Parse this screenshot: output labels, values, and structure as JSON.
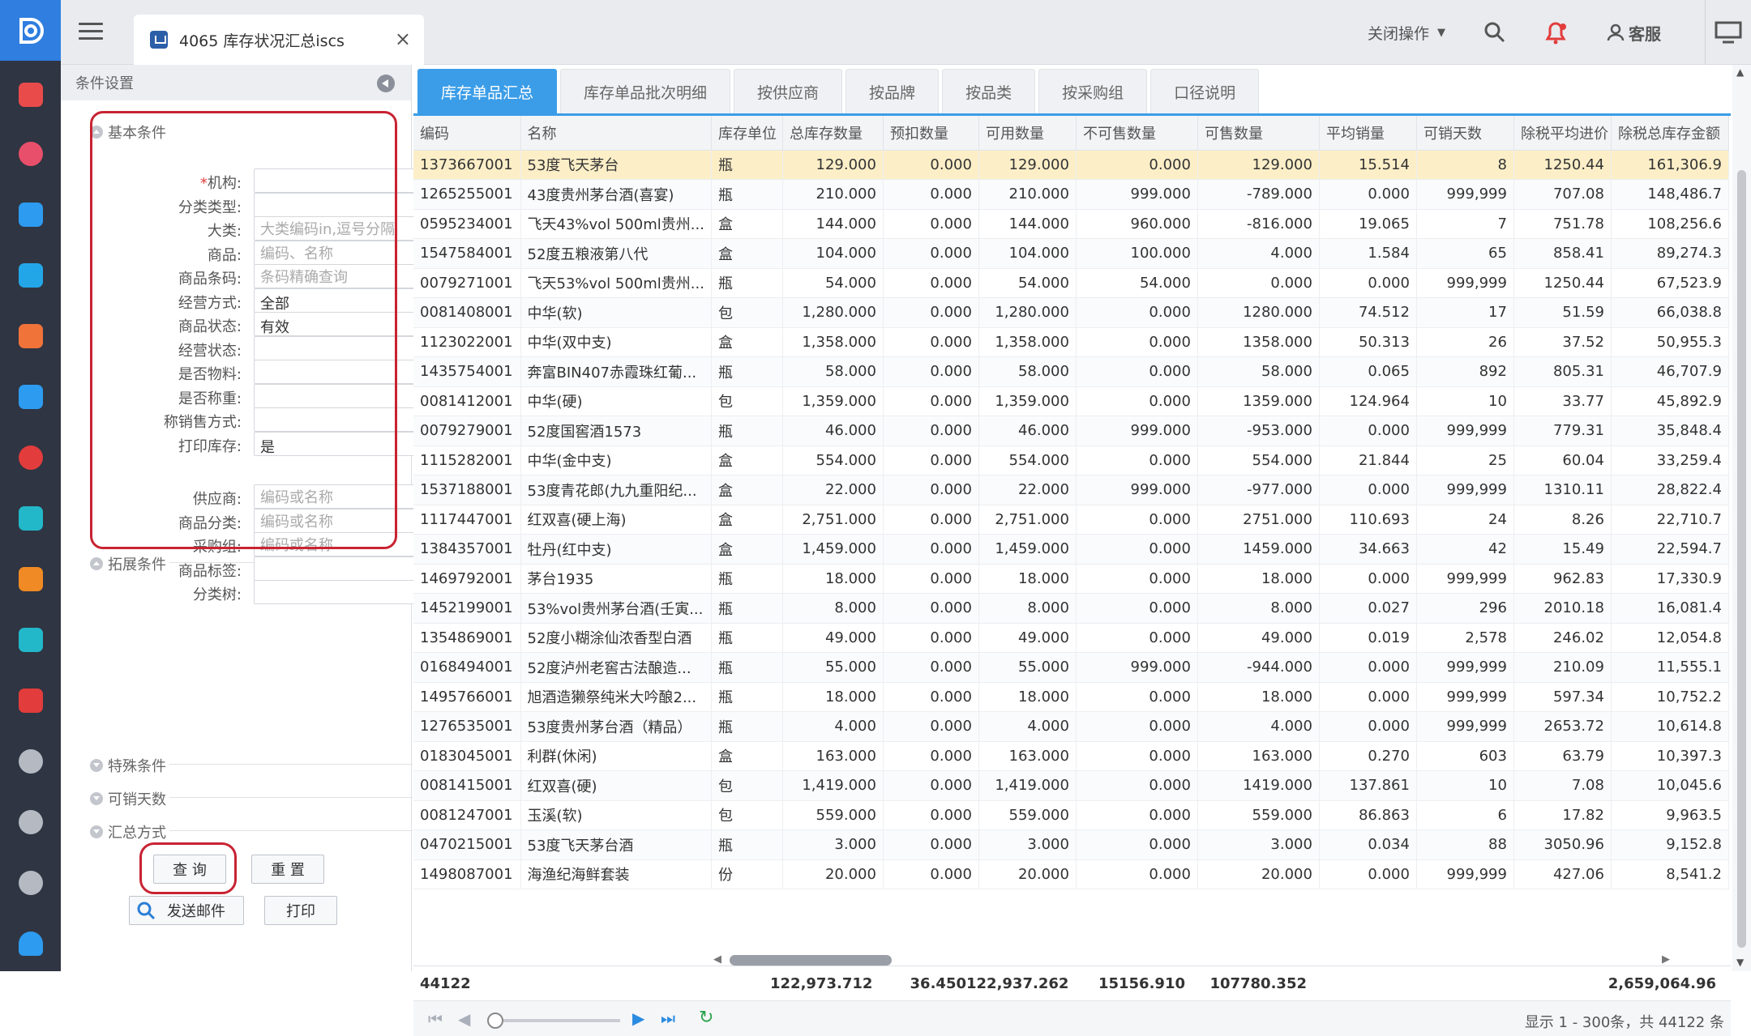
{
  "app": {
    "tab_title": "4065 库存状况汇总iscs",
    "tab_close": "×"
  },
  "topbar": {
    "close_ops": "关闭操作",
    "service": "客服"
  },
  "panel": {
    "title": "条件设置",
    "sections": {
      "basic": "基本条件",
      "extended": "拓展条件",
      "special": "特殊条件",
      "days": "可销天数",
      "summary": "汇总方式"
    },
    "basic_fields": [
      {
        "label": "机构:",
        "required": true,
        "value": "",
        "placeholder": "",
        "select": true
      },
      {
        "label": "分类类型:",
        "value": "",
        "placeholder": "",
        "select": true
      },
      {
        "label": "大类:",
        "value": "",
        "placeholder": "大类编码in,逗号分隔",
        "select": false
      },
      {
        "label": "商品:",
        "value": "",
        "placeholder": "编码、名称",
        "select": false
      },
      {
        "label": "商品条码:",
        "value": "",
        "placeholder": "条码精确查询",
        "select": false
      },
      {
        "label": "经营方式:",
        "value": "全部",
        "placeholder": "",
        "select": true
      },
      {
        "label": "商品状态:",
        "value": "有效",
        "placeholder": "",
        "select": true
      },
      {
        "label": "经营状态:",
        "value": "",
        "placeholder": "",
        "select": true
      },
      {
        "label": "是否物料:",
        "value": "",
        "placeholder": "",
        "select": true
      },
      {
        "label": "是否称重:",
        "value": "",
        "placeholder": "",
        "select": true
      },
      {
        "label": "称销售方式:",
        "value": "",
        "placeholder": "",
        "select": true
      },
      {
        "label": "打印库存:",
        "value": "是",
        "placeholder": "",
        "select": true
      }
    ],
    "ext_fields": [
      {
        "label": "供应商:",
        "value": "",
        "placeholder": "编码或名称",
        "select": false
      },
      {
        "label": "商品分类:",
        "value": "",
        "placeholder": "编码或名称",
        "select": false
      },
      {
        "label": "采购组:",
        "value": "",
        "placeholder": "编码或名称",
        "select": false
      },
      {
        "label": "商品标签:",
        "value": "",
        "placeholder": "",
        "select": true
      },
      {
        "label": "分类树:",
        "value": "",
        "placeholder": "",
        "select": true
      }
    ],
    "buttons": {
      "query": "查 询",
      "reset": "重 置",
      "send_mail": "发送邮件",
      "print": "打印"
    }
  },
  "subtabs": [
    "库存单品汇总",
    "库存单品批次明细",
    "按供应商",
    "按品牌",
    "按品类",
    "按采购组",
    "口径说明"
  ],
  "table": {
    "columns": [
      "编码",
      "名称",
      "库存单位",
      "总库存数量",
      "预扣数量",
      "可用数量",
      "不可售数量",
      "可售数量",
      "平均销量",
      "可销天数",
      "除税平均进价",
      "除税总库存金额"
    ],
    "rows": [
      [
        "1373667001",
        "53度飞天茅台",
        "瓶",
        "129.000",
        "0.000",
        "129.000",
        "0.000",
        "129.000",
        "15.514",
        "8",
        "1250.44",
        "161,306.9"
      ],
      [
        "1265255001",
        "43度贵州茅台酒(喜宴)",
        "瓶",
        "210.000",
        "0.000",
        "210.000",
        "999.000",
        "-789.000",
        "0.000",
        "999,999",
        "707.08",
        "148,486.7"
      ],
      [
        "0595234001",
        "飞天43%vol 500ml贵州...",
        "盒",
        "144.000",
        "0.000",
        "144.000",
        "960.000",
        "-816.000",
        "19.065",
        "7",
        "751.78",
        "108,256.6"
      ],
      [
        "1547584001",
        "52度五粮液第八代",
        "盒",
        "104.000",
        "0.000",
        "104.000",
        "100.000",
        "4.000",
        "1.584",
        "65",
        "858.41",
        "89,274.3"
      ],
      [
        "0079271001",
        "飞天53%vol 500ml贵州...",
        "瓶",
        "54.000",
        "0.000",
        "54.000",
        "54.000",
        "0.000",
        "0.000",
        "999,999",
        "1250.44",
        "67,523.9"
      ],
      [
        "0081408001",
        "中华(软)",
        "包",
        "1,280.000",
        "0.000",
        "1,280.000",
        "0.000",
        "1280.000",
        "74.512",
        "17",
        "51.59",
        "66,038.8"
      ],
      [
        "1123022001",
        "中华(双中支)",
        "盒",
        "1,358.000",
        "0.000",
        "1,358.000",
        "0.000",
        "1358.000",
        "50.313",
        "26",
        "37.52",
        "50,955.3"
      ],
      [
        "1435754001",
        "奔富BIN407赤霞珠红葡...",
        "瓶",
        "58.000",
        "0.000",
        "58.000",
        "0.000",
        "58.000",
        "0.065",
        "892",
        "805.31",
        "46,707.9"
      ],
      [
        "0081412001",
        "中华(硬)",
        "包",
        "1,359.000",
        "0.000",
        "1,359.000",
        "0.000",
        "1359.000",
        "124.964",
        "10",
        "33.77",
        "45,892.9"
      ],
      [
        "0079279001",
        "52度国窖酒1573",
        "瓶",
        "46.000",
        "0.000",
        "46.000",
        "999.000",
        "-953.000",
        "0.000",
        "999,999",
        "779.31",
        "35,848.4"
      ],
      [
        "1115282001",
        "中华(金中支)",
        "盒",
        "554.000",
        "0.000",
        "554.000",
        "0.000",
        "554.000",
        "21.844",
        "25",
        "60.04",
        "33,259.4"
      ],
      [
        "1537188001",
        "53度青花郎(九九重阳纪...",
        "盒",
        "22.000",
        "0.000",
        "22.000",
        "999.000",
        "-977.000",
        "0.000",
        "999,999",
        "1310.11",
        "28,822.4"
      ],
      [
        "1117447001",
        "红双喜(硬上海)",
        "盒",
        "2,751.000",
        "0.000",
        "2,751.000",
        "0.000",
        "2751.000",
        "110.693",
        "24",
        "8.26",
        "22,710.7"
      ],
      [
        "1384357001",
        "牡丹(红中支)",
        "盒",
        "1,459.000",
        "0.000",
        "1,459.000",
        "0.000",
        "1459.000",
        "34.663",
        "42",
        "15.49",
        "22,594.7"
      ],
      [
        "1469792001",
        "茅台1935",
        "瓶",
        "18.000",
        "0.000",
        "18.000",
        "0.000",
        "18.000",
        "0.000",
        "999,999",
        "962.83",
        "17,330.9"
      ],
      [
        "1452199001",
        "53%vol贵州茅台酒(壬寅...",
        "瓶",
        "8.000",
        "0.000",
        "8.000",
        "0.000",
        "8.000",
        "0.027",
        "296",
        "2010.18",
        "16,081.4"
      ],
      [
        "1354869001",
        "52度小糊涂仙浓香型白酒",
        "瓶",
        "49.000",
        "0.000",
        "49.000",
        "0.000",
        "49.000",
        "0.019",
        "2,578",
        "246.02",
        "12,054.8"
      ],
      [
        "0168494001",
        "52度泸州老窖古法酿造...",
        "瓶",
        "55.000",
        "0.000",
        "55.000",
        "999.000",
        "-944.000",
        "0.000",
        "999,999",
        "210.09",
        "11,555.1"
      ],
      [
        "1495766001",
        "旭酒造獭祭纯米大吟酿2...",
        "瓶",
        "18.000",
        "0.000",
        "18.000",
        "0.000",
        "18.000",
        "0.000",
        "999,999",
        "597.34",
        "10,752.2"
      ],
      [
        "1276535001",
        "53度贵州茅台酒（精品）",
        "瓶",
        "4.000",
        "0.000",
        "4.000",
        "0.000",
        "4.000",
        "0.000",
        "999,999",
        "2653.72",
        "10,614.8"
      ],
      [
        "0183045001",
        "利群(休闲)",
        "盒",
        "163.000",
        "0.000",
        "163.000",
        "0.000",
        "163.000",
        "0.270",
        "603",
        "63.79",
        "10,397.3"
      ],
      [
        "0081415001",
        "红双喜(硬)",
        "包",
        "1,419.000",
        "0.000",
        "1,419.000",
        "0.000",
        "1419.000",
        "137.861",
        "10",
        "7.08",
        "10,045.6"
      ],
      [
        "0081247001",
        "玉溪(软)",
        "包",
        "559.000",
        "0.000",
        "559.000",
        "0.000",
        "559.000",
        "86.863",
        "6",
        "17.82",
        "9,963.5"
      ],
      [
        "0470215001",
        "53度飞天茅台酒",
        "瓶",
        "3.000",
        "0.000",
        "3.000",
        "0.000",
        "3.000",
        "0.034",
        "88",
        "3050.96",
        "9,152.8"
      ],
      [
        "1498087001",
        "海渔纪海鲜套装",
        "份",
        "20.000",
        "0.000",
        "20.000",
        "0.000",
        "20.000",
        "0.000",
        "999,999",
        "427.06",
        "8,541.2"
      ]
    ],
    "totals": {
      "count": "44122",
      "total_qty": "122,973.712",
      "withheld": "36.450",
      "available": "122,937.262",
      "unsellable": "15156.910",
      "sellable": "107780.352",
      "amount": "2,659,064.96"
    }
  },
  "pager": {
    "info": "显示 1 - 300条，共 44122 条"
  },
  "colors": {
    "accent": "#3b9de8",
    "rail": "#2f3542",
    "logo": "#2f7ee0",
    "highlight_row": "#fcefc8",
    "annotation_red": "#c82333"
  }
}
